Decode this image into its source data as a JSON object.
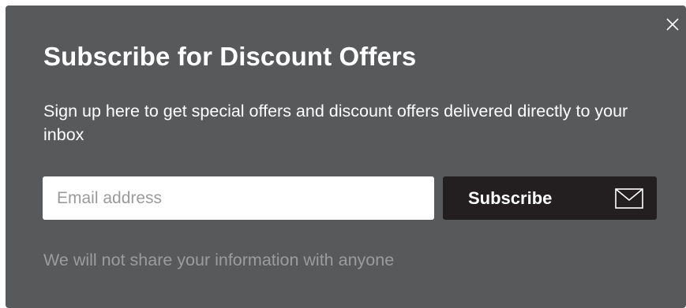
{
  "modal": {
    "title": "Subscribe for Discount Offers",
    "description": "Sign up here to get special offers and discount offers delivered directly to your inbox",
    "email_placeholder": "Email address",
    "email_value": "",
    "subscribe_label": "Subscribe",
    "disclaimer": "We will not share your information with anyone",
    "icons": {
      "close": "close-icon",
      "mail": "envelope-icon"
    },
    "colors": {
      "background": "#58595b",
      "button": "#231f20",
      "text": "#ffffff",
      "muted_text": "#9c9c9c"
    }
  }
}
